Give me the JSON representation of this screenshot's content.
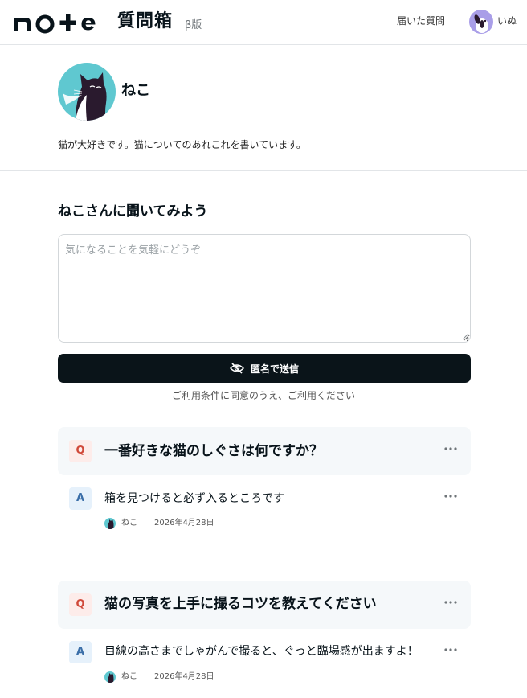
{
  "header": {
    "logo_text": "note",
    "product_name": "質問箱",
    "beta_label": "β版",
    "received_questions_link": "届いた質問",
    "user_name": "いぬ"
  },
  "profile": {
    "name": "ねこ",
    "bio": "猫が大好きです。猫についてのあれこれを書いています。"
  },
  "ask": {
    "title": "ねこさんに聞いてみよう",
    "placeholder": "気になることを気軽にどうぞ",
    "value": "",
    "send_label": "匿名で送信",
    "terms_link": "ご利用条件",
    "terms_text": "に同意のうえ、ご利用ください"
  },
  "qa": [
    {
      "q_badge": "Q",
      "question": "一番好きな猫のしぐさは何ですか？",
      "a_badge": "A",
      "answer": "箱を見つけると必ず入るところです",
      "answerer": "ねこ",
      "date": "2026年4月28日"
    },
    {
      "q_badge": "Q",
      "question": "猫の写真を上手に撮るコツを教えてください",
      "a_badge": "A",
      "answer": "目線の高さまでしゃがんで撮ると、ぐっと臨場感が出ますよ！",
      "answerer": "ねこ",
      "date": "2026年4月28日"
    }
  ],
  "colors": {
    "accent_dark": "#0a1419",
    "avatar_teal": "#5fc8d0",
    "q_badge_bg": "#fdecea",
    "q_badge_fg": "#d0493a",
    "a_badge_bg": "#e6f1fb",
    "a_badge_fg": "#3a6ea8",
    "card_bg": "#f5f8fa"
  },
  "icons": {
    "send": "eye-slash-icon",
    "more": "more-dots-icon"
  }
}
